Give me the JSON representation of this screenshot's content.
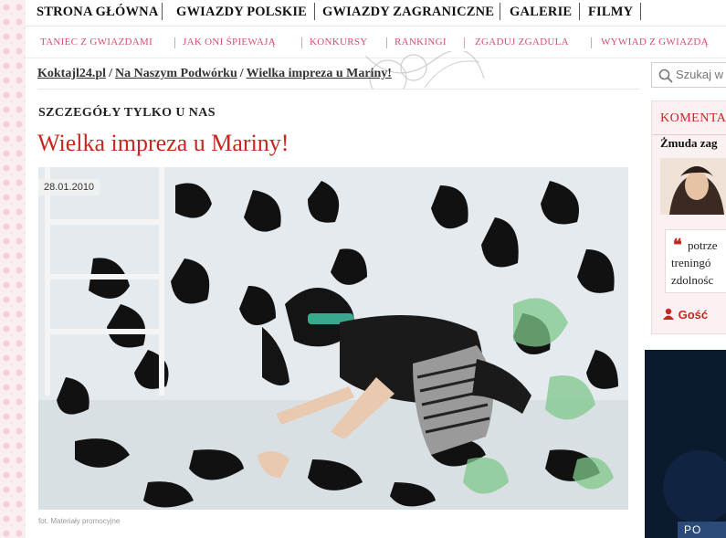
{
  "nav": {
    "main": [
      "STRONA GŁÓWNA",
      "GWIAZDY POLSKIE",
      "GWIAZDY ZAGRANICZNE",
      "GALERIE",
      "FILMY"
    ],
    "sub": [
      "TANIEC Z GWIAZDAMI",
      "JAK ONI ŚPIEWAJĄ",
      "KONKURSY",
      "RANKINGI",
      "ZGADUJ ZGADULA",
      "WYWIAD Z GWIAZDĄ"
    ]
  },
  "breadcrumb": {
    "home": "Koktajl24.pl",
    "section": "Na Naszym Podwórku",
    "current": "Wielka impreza u Mariny!",
    "separator": "/"
  },
  "article": {
    "kicker": "SZCZEGÓŁY TYLKO U NAS",
    "title": "Wielka impreza u Mariny!",
    "date": "28.01.2010",
    "photo_caption": "fot. Materiały promocyjne"
  },
  "sidebar": {
    "search_placeholder": "Szukaj w",
    "comments_header": "KOMENTA",
    "comment_author": "Żmuda zag",
    "comment_lines": [
      "potrze",
      "treningó",
      "zdolnośc"
    ],
    "quote_mark": "❝",
    "guest_label": "Gość",
    "ad_button": "PO"
  },
  "colors": {
    "accent_red": "#c8261f",
    "subnav_pink": "#d44f6d",
    "comments_bg": "#fbf1f3"
  }
}
